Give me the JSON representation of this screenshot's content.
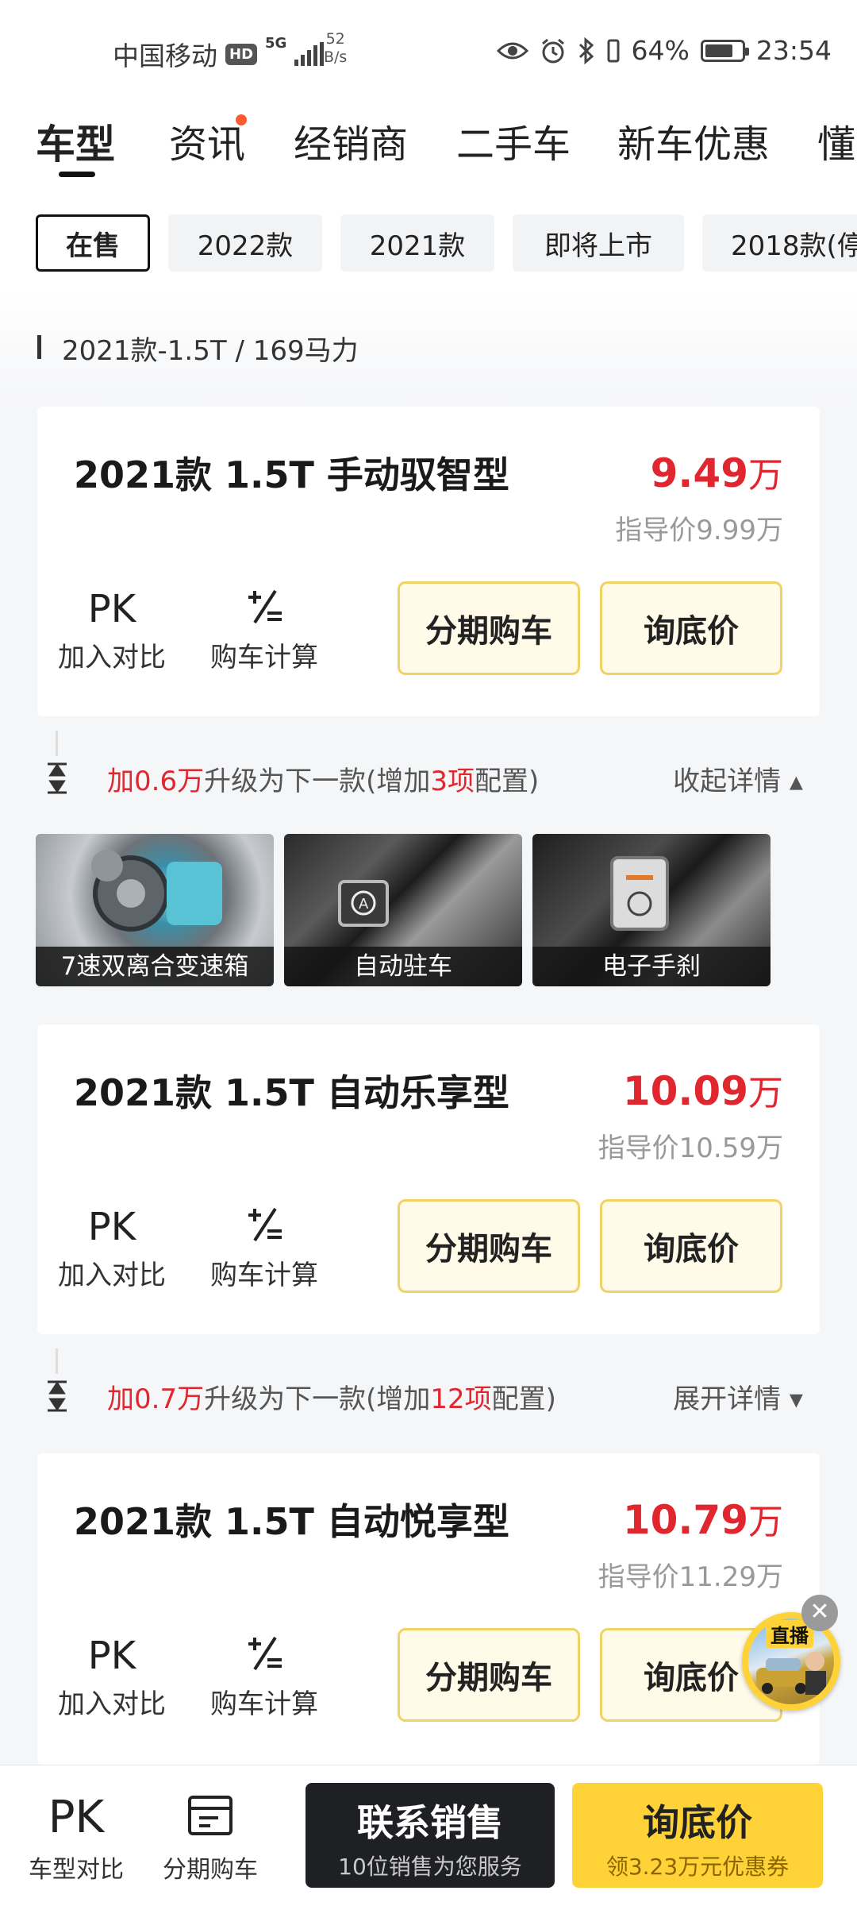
{
  "status_bar": {
    "carrier": "中国移动",
    "hd": "HD",
    "network": "5G",
    "speed_value": "52",
    "speed_unit": "B/s",
    "battery": "64%",
    "time": "23:54"
  },
  "tabs": [
    {
      "label": "车型",
      "active": true
    },
    {
      "label": "资讯",
      "badge": true
    },
    {
      "label": "经销商"
    },
    {
      "label": "二手车"
    },
    {
      "label": "新车优惠"
    },
    {
      "label": "懂"
    }
  ],
  "year_filters": [
    "在售",
    "2022款",
    "2021款",
    "即将上市",
    "2018款(停"
  ],
  "section_title": "2021款-1.5T / 169马力",
  "common": {
    "pk_icon": "PK",
    "compare_label": "加入对比",
    "calc_label": "购车计算",
    "installment_label": "分期购车",
    "floor_price_label": "询底价"
  },
  "models": [
    {
      "name": "2021款 1.5T 手动驭智型",
      "price": "9.49",
      "unit": "万",
      "guide": "指导价9.99万"
    },
    {
      "name": "2021款 1.5T 自动乐享型",
      "price": "10.09",
      "unit": "万",
      "guide": "指导价10.59万"
    },
    {
      "name": "2021款 1.5T 自动悦享型",
      "price": "10.79",
      "unit": "万",
      "guide": "指导价11.29万"
    }
  ],
  "upgrades": [
    {
      "add": "加0.6万",
      "mid": "升级为下一款(增加",
      "count": "3项",
      "tail": "配置)",
      "toggle": "收起详情 ▴"
    },
    {
      "add": "加0.7万",
      "mid": "升级为下一款(增加",
      "count": "12项",
      "tail": "配置)",
      "toggle": "展开详情 ▾"
    }
  ],
  "features": [
    "7速双离合变速箱",
    "自动驻车",
    "电子手刹"
  ],
  "live": {
    "label": "直播",
    "close": "✕"
  },
  "bottom_bar": {
    "compare_icon": "PK",
    "compare_label": "车型对比",
    "installment_label": "分期购车",
    "contact_title": "联系销售",
    "contact_sub": "10位销售为您服务",
    "ask_title": "询底价",
    "ask_sub": "领3.23万元优惠券"
  },
  "colors": {
    "price_red": "#e0262e",
    "accent_yellow": "#ffd337",
    "dark": "#1e2024"
  }
}
